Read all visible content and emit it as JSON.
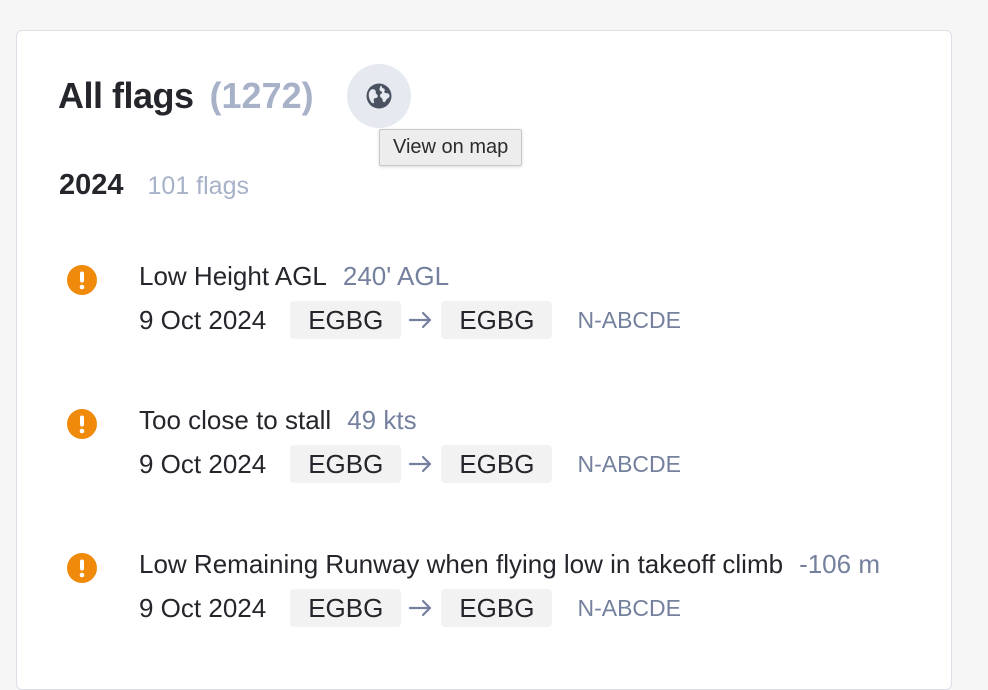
{
  "header": {
    "title": "All flags",
    "count": "(1272)",
    "map_button_icon": "globe-icon",
    "tooltip": "View on map"
  },
  "year_group": {
    "year": "2024",
    "count": "101 flags"
  },
  "colors": {
    "warning": "#f08a0b",
    "muted": "#a7b1c8",
    "value": "#74809e"
  },
  "flags": [
    {
      "icon": "exclamation-icon",
      "title": "Low Height AGL",
      "value": "240' AGL",
      "date": "9 Oct 2024",
      "from": "EGBG",
      "to": "EGBG",
      "registration": "N-ABCDE"
    },
    {
      "icon": "exclamation-icon",
      "title": "Too close to stall",
      "value": "49 kts",
      "date": "9 Oct 2024",
      "from": "EGBG",
      "to": "EGBG",
      "registration": "N-ABCDE"
    },
    {
      "icon": "exclamation-icon",
      "title": "Low Remaining Runway when flying low in takeoff climb",
      "value": "-106 m",
      "date": "9 Oct 2024",
      "from": "EGBG",
      "to": "EGBG",
      "registration": "N-ABCDE"
    }
  ]
}
